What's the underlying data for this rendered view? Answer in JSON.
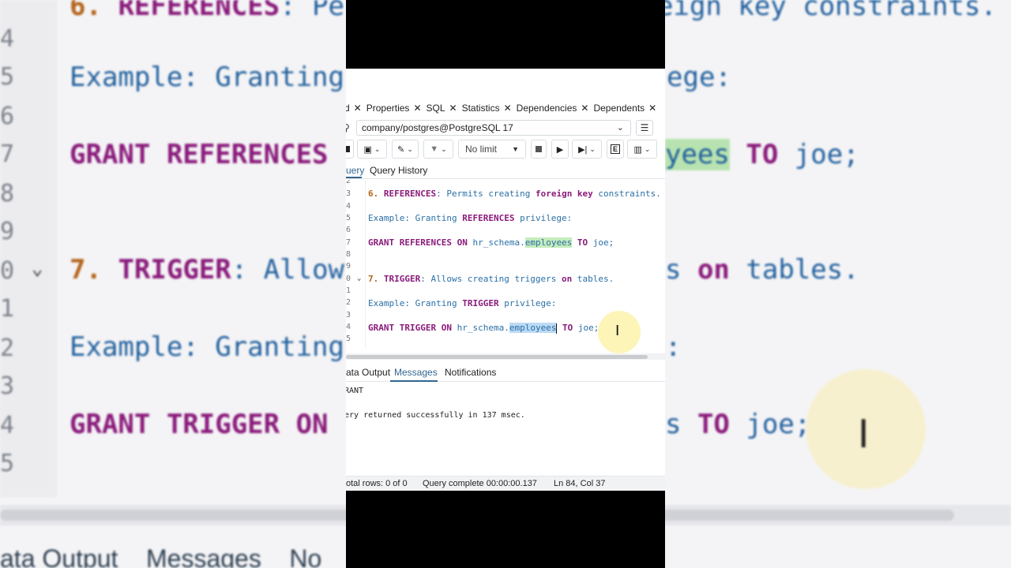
{
  "background": {
    "lines": [
      {
        "num": "4",
        "text": ""
      },
      {
        "num": "5",
        "text": "Example: Granting"
      },
      {
        "num": "6",
        "text": ""
      },
      {
        "num": "7",
        "pre": "GRANT REFERENCES",
        "mid": "yees",
        "post": " TO joe;"
      },
      {
        "num": "8",
        "text": ""
      },
      {
        "num": "9",
        "text": ""
      },
      {
        "num": "0",
        "pre": "7. TRIGGER",
        "post": ": Allow"
      },
      {
        "num": "1",
        "text": ""
      },
      {
        "num": "2",
        "text": "Example: Granting"
      },
      {
        "num": "3",
        "text": ""
      },
      {
        "num": "4",
        "pre": "GRANT TRIGGER ON",
        "post": "s TO joe;"
      },
      {
        "num": "5",
        "text": ""
      }
    ],
    "top_fragment_left": "6. REFERENCES: Pe",
    "top_fragment_right": "eign key constraints.",
    "right_fragment_5": "ege:",
    "right_fragment_10": "s on tables.",
    "right_fragment_12": ":",
    "tabs_text": "ata Output    Messages    No"
  },
  "tabs": [
    {
      "label": "rd"
    },
    {
      "label": "Properties"
    },
    {
      "label": "SQL"
    },
    {
      "label": "Statistics"
    },
    {
      "label": "Dependencies"
    },
    {
      "label": "Dependents"
    }
  ],
  "connection": {
    "value": "company/postgres@PostgreSQL 17"
  },
  "toolbar": {
    "limit_label": "No limit",
    "explain_label": "E"
  },
  "subtabs": {
    "query": "uery",
    "history": "Query History"
  },
  "editor": {
    "line_numbers": [
      "2",
      "3",
      "4",
      "5",
      "6",
      "7",
      "8",
      "9",
      "0",
      "1",
      "2",
      "3",
      "4",
      "5"
    ],
    "l3_num": "6.",
    "l3_kw": "REFERENCES",
    "l3_a": ": Permits creating ",
    "l3_b": "foreign key",
    "l3_c": " constraints.",
    "l5_a": "Example: Granting ",
    "l5_kw": "REFERENCES",
    "l5_b": " privilege:",
    "l7_kw1": "GRANT REFERENCES ON",
    "l7_a": " hr_schema.",
    "l7_hl": "employees",
    "l7_kw2": " TO",
    "l7_b": " joe;",
    "l10_num": "7.",
    "l10_kw": "TRIGGER",
    "l10_a": ": Allows creating triggers ",
    "l10_on": "on",
    "l10_b": " tables.",
    "l12_a": "Example: Granting ",
    "l12_kw": "TRIGGER",
    "l12_b": " privilege:",
    "l14_kw1": "GRANT TRIGGER ON",
    "l14_a": " hr_schema.",
    "l14_hl": "employees",
    "l14_kw2": " TO",
    "l14_b": " joe;"
  },
  "output_tabs": {
    "data_output": "ata Output",
    "messages": "Messages",
    "notifications": "Notifications"
  },
  "messages": {
    "line1": "RANT",
    "line2": "ery returned successfully in 137 msec."
  },
  "status": {
    "rows": "otal rows: 0 of 0",
    "complete": "Query complete 00:00:00.137",
    "position": "Ln 84, Col 37"
  }
}
